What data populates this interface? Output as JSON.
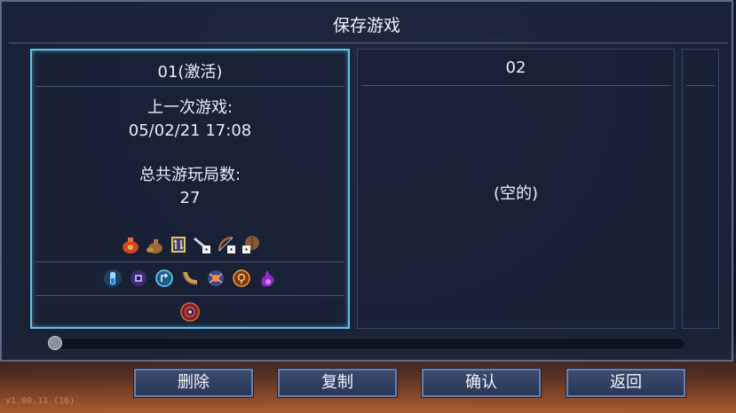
{
  "dialog": {
    "title": "保存游戏"
  },
  "slots": [
    {
      "name": "01(激活)",
      "last_played_label": "上一次游戏:",
      "last_played_value": "05/02/21  17:08",
      "total_runs_label": "总共游玩局数:",
      "total_runs_value": "27",
      "icon_rows": [
        [
          "red-money-bag-icon",
          "brown-bag-icon",
          "swap-scroll-icon",
          "sword-dice-icon",
          "bow-dice-icon",
          "shield-dice-icon"
        ],
        [
          "blue-flask-icon",
          "purple-rune-icon",
          "blue-arrow-rune-icon",
          "horn-icon",
          "spider-orb-icon",
          "orange-rune-icon",
          "purple-flame-icon"
        ],
        [
          "red-eye-amulet-icon"
        ]
      ]
    },
    {
      "name": "02",
      "empty_label": "(空的)"
    }
  ],
  "buttons": {
    "delete": "删除",
    "copy": "复制",
    "confirm": "确认",
    "back": "返回"
  },
  "version": "v1.00.11 (16)",
  "colors": {
    "active_border": "#5fc3ec",
    "panel_border": "#5d6b88",
    "button_bg": "#2f3d5e"
  }
}
